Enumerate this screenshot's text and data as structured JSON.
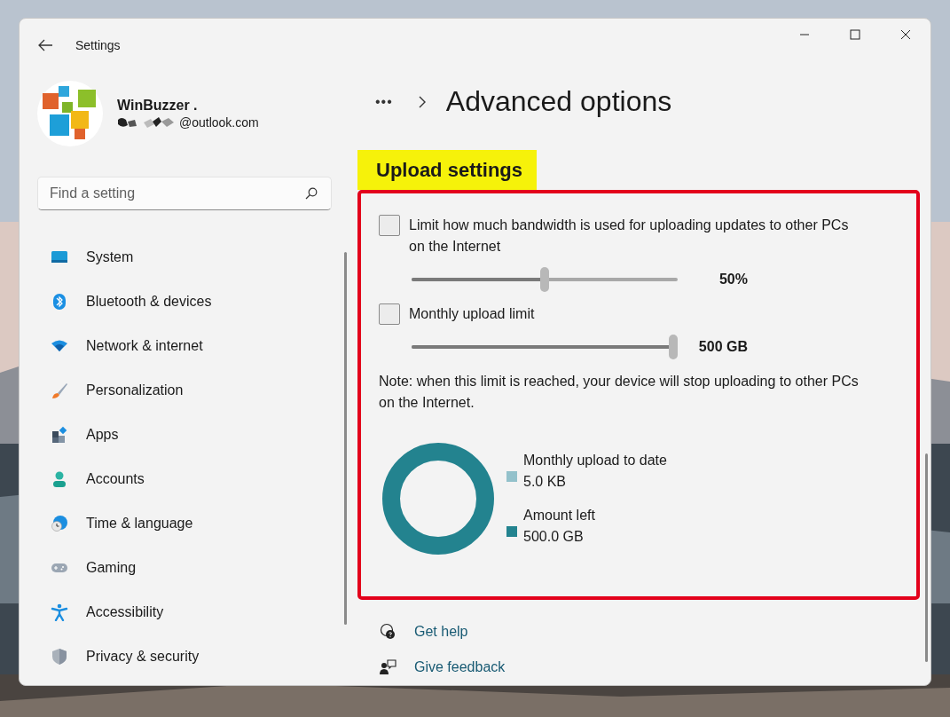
{
  "window": {
    "title": "Settings"
  },
  "profile": {
    "name": "WinBuzzer .",
    "email": "@outlook.com"
  },
  "search": {
    "placeholder": "Find a setting"
  },
  "nav": [
    {
      "label": "System"
    },
    {
      "label": "Bluetooth & devices"
    },
    {
      "label": "Network & internet"
    },
    {
      "label": "Personalization"
    },
    {
      "label": "Apps"
    },
    {
      "label": "Accounts"
    },
    {
      "label": "Time & language"
    },
    {
      "label": "Gaming"
    },
    {
      "label": "Accessibility"
    },
    {
      "label": "Privacy & security"
    }
  ],
  "breadcrumb": {
    "overflow": "•••",
    "title": "Advanced options"
  },
  "section": {
    "title": "Upload settings",
    "highlighted": true,
    "outlined": true,
    "options": [
      {
        "kind": "checkbox",
        "label": "Limit how much bandwidth is used for uploading updates to other PCs on the Internet",
        "checked": false
      },
      {
        "kind": "slider",
        "level": 0.5,
        "reading": "50%"
      },
      {
        "kind": "checkbox",
        "label": "Monthly upload limit",
        "checked": false
      },
      {
        "kind": "slider",
        "level": 1,
        "reading": "500 GB"
      },
      {
        "kind": "note",
        "text": "Note: when this limit is reached, your device will stop uploading to other PCs on the Internet."
      }
    ],
    "usage": [
      {
        "label": "Monthly upload to date",
        "value": "5.0 KB",
        "color": "#93c1cb"
      },
      {
        "label": "Amount left",
        "value": "500.0 GB",
        "color": "#23838f"
      }
    ]
  },
  "links": [
    {
      "label": "Get help"
    },
    {
      "label": "Give feedback"
    }
  ]
}
